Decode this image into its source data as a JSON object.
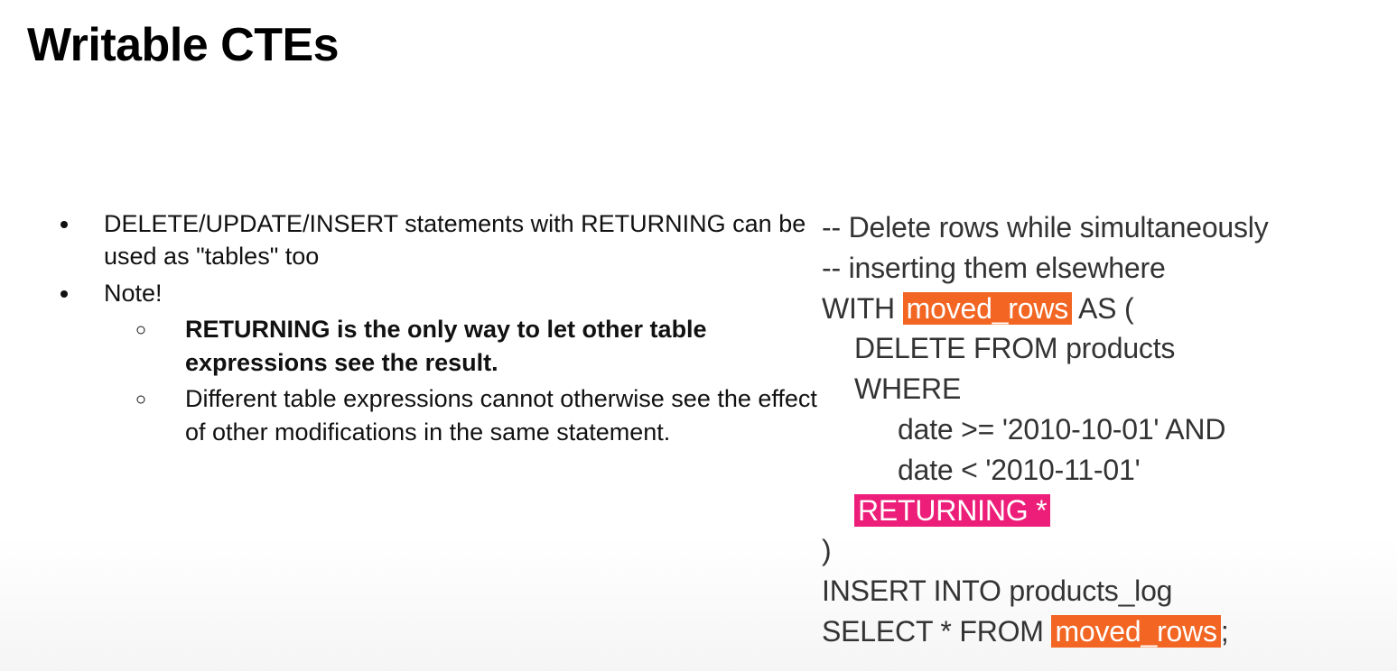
{
  "title": "Writable CTEs",
  "bullets": {
    "b1": "DELETE/UPDATE/INSERT statements with RETURNING can be used as \"tables\" too",
    "b2": "Note!",
    "b2a": "RETURNING is the only way to let other table expressions see the result.",
    "b2b": "Different table expressions cannot otherwise see the effect of other modifications in the same statement."
  },
  "code": {
    "c1": "-- Delete rows while simultaneously",
    "c2": "-- inserting them elsewhere",
    "c3a": "WITH ",
    "c3b": "moved_rows",
    "c3c": " AS (",
    "c4": "DELETE FROM products",
    "c5": "WHERE",
    "c6": "date >= '2010-10-01' AND",
    "c7": "date < '2010-11-01'",
    "c8": "RETURNING *",
    "c9": ")",
    "c10": "INSERT INTO products_log",
    "c11a": "SELECT * FROM ",
    "c11b": "moved_rows",
    "c11c": ";"
  }
}
